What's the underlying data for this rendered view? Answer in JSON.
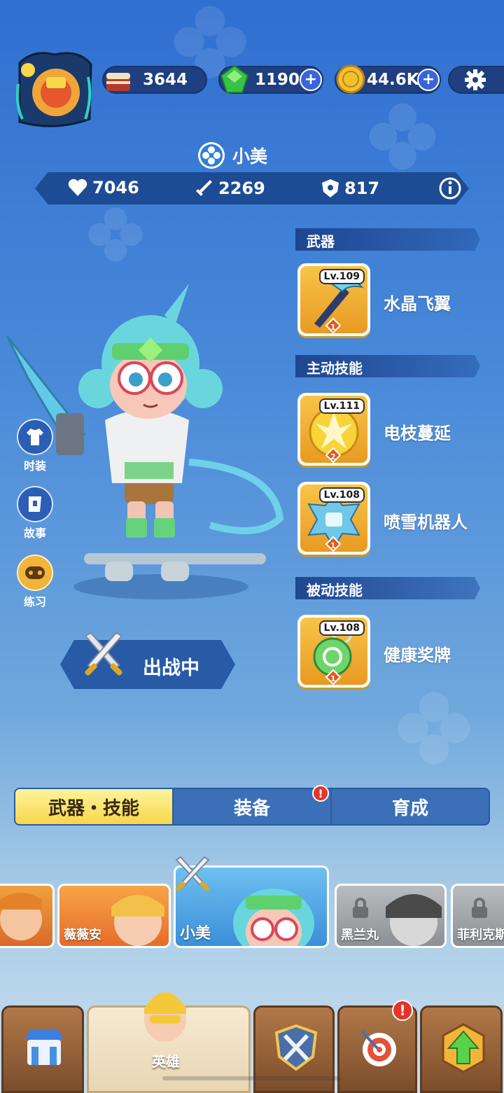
{
  "resources": {
    "stamina": "3644",
    "gems": "1190",
    "coins": "44.6K",
    "plus": "+"
  },
  "hero": {
    "name": "小美",
    "stats": {
      "hp": "7046",
      "attack": "2269",
      "defense": "817"
    }
  },
  "sections": {
    "weapon": "武器",
    "active": "主动技能",
    "passive": "被动技能"
  },
  "cards": [
    {
      "level": "Lv.109",
      "name": "水晶飞翼",
      "stars": "1"
    },
    {
      "level": "Lv.111",
      "name": "电枝蔓延",
      "stars": "2"
    },
    {
      "level": "Lv.108",
      "name": "喷雪机器人",
      "stars": "1"
    },
    {
      "level": "Lv.108",
      "name": "健康奖牌",
      "stars": "1"
    }
  ],
  "side": {
    "fashion": "时装",
    "story": "故事",
    "practice": "练习"
  },
  "deploy_label": "出战中",
  "tabs": [
    "武器・技能",
    "装备",
    "育成"
  ],
  "badge": "!",
  "roster": [
    "薇薇安",
    "小美",
    "黑兰丸",
    "菲利克斯"
  ],
  "nav_active": "英雄",
  "colors": {
    "accent": "#f7d64a",
    "badge": "#e3352a",
    "panel": "#1d4c94"
  }
}
